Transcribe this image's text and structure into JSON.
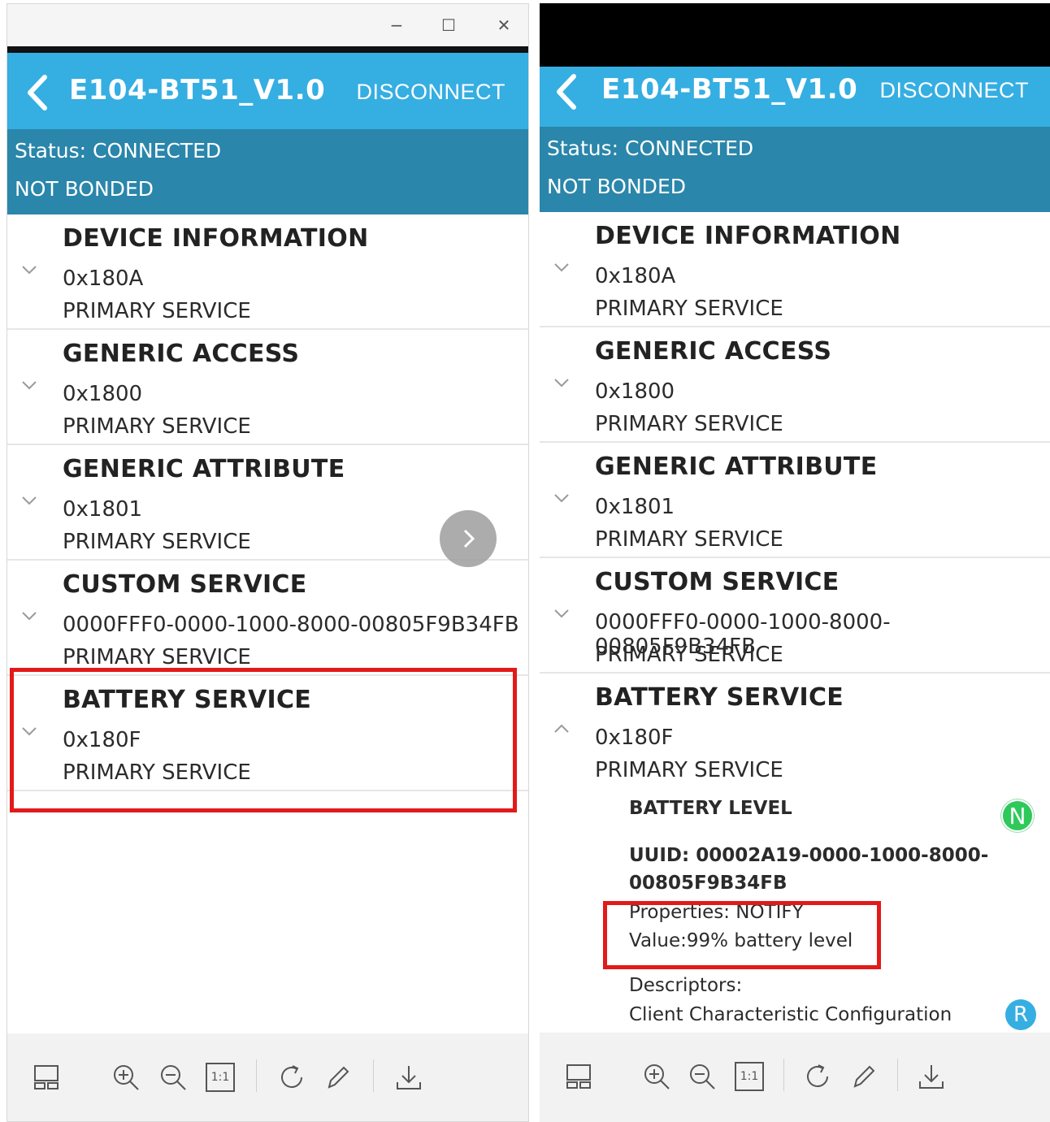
{
  "window": {
    "minimize_label": "−",
    "maximize_label": "☐",
    "close_label": "✕"
  },
  "left": {
    "app_title": "E104-BT51_V1.0",
    "disconnect_label": "DISCONNECT",
    "status_line": "Status: CONNECTED",
    "bond_line": "NOT BONDED",
    "services": [
      {
        "name": "DEVICE INFORMATION",
        "uuid": "0x180A",
        "type": "PRIMARY SERVICE",
        "expanded": false
      },
      {
        "name": "GENERIC ACCESS",
        "uuid": "0x1800",
        "type": "PRIMARY SERVICE",
        "expanded": false
      },
      {
        "name": "GENERIC ATTRIBUTE",
        "uuid": "0x1801",
        "type": "PRIMARY SERVICE",
        "expanded": false
      },
      {
        "name": "CUSTOM SERVICE",
        "uuid": "0000FFF0-0000-1000-8000-00805F9B34FB",
        "type": "PRIMARY SERVICE",
        "expanded": false
      },
      {
        "name": "BATTERY SERVICE",
        "uuid": "0x180F",
        "type": "PRIMARY SERVICE",
        "expanded": false
      }
    ]
  },
  "right": {
    "app_title": "E104-BT51_V1.0",
    "disconnect_label": "DISCONNECT",
    "status_line": "Status: CONNECTED",
    "bond_line": "NOT BONDED",
    "services": [
      {
        "name": "DEVICE INFORMATION",
        "uuid": "0x180A",
        "type": "PRIMARY SERVICE",
        "expanded": false
      },
      {
        "name": "GENERIC ACCESS",
        "uuid": "0x1800",
        "type": "PRIMARY SERVICE",
        "expanded": false
      },
      {
        "name": "GENERIC ATTRIBUTE",
        "uuid": "0x1801",
        "type": "PRIMARY SERVICE",
        "expanded": false
      },
      {
        "name": "CUSTOM SERVICE",
        "uuid": "0000FFF0-0000-1000-8000-00805F9B34FB",
        "type": "PRIMARY SERVICE",
        "expanded": false
      },
      {
        "name": "BATTERY SERVICE",
        "uuid": "0x180F",
        "type": "PRIMARY SERVICE",
        "expanded": true
      }
    ],
    "characteristic": {
      "name": "BATTERY LEVEL",
      "uuid_line1": "UUID: 00002A19-0000-1000-8000-",
      "uuid_line2": "00805F9B34FB",
      "properties": "Properties: NOTIFY",
      "value": "Value:99% battery level",
      "descriptors_label": "Descriptors:",
      "descriptor_name": "Client Characteristic Configuration",
      "notify_badge": "N",
      "read_badge": "R"
    }
  },
  "toolbar": {
    "icons": [
      "layout-icon",
      "zoom-in-icon",
      "zoom-out-icon",
      "actual-size-icon",
      "rotate-icon",
      "edit-icon",
      "download-icon"
    ],
    "actual_size_label": "1:1"
  },
  "colors": {
    "app_bar": "#35aee2",
    "status_bar": "#2a86aa",
    "highlight_box": "#e21a1a",
    "notify_badge": "#2ec95a",
    "read_badge": "#35aee2"
  }
}
